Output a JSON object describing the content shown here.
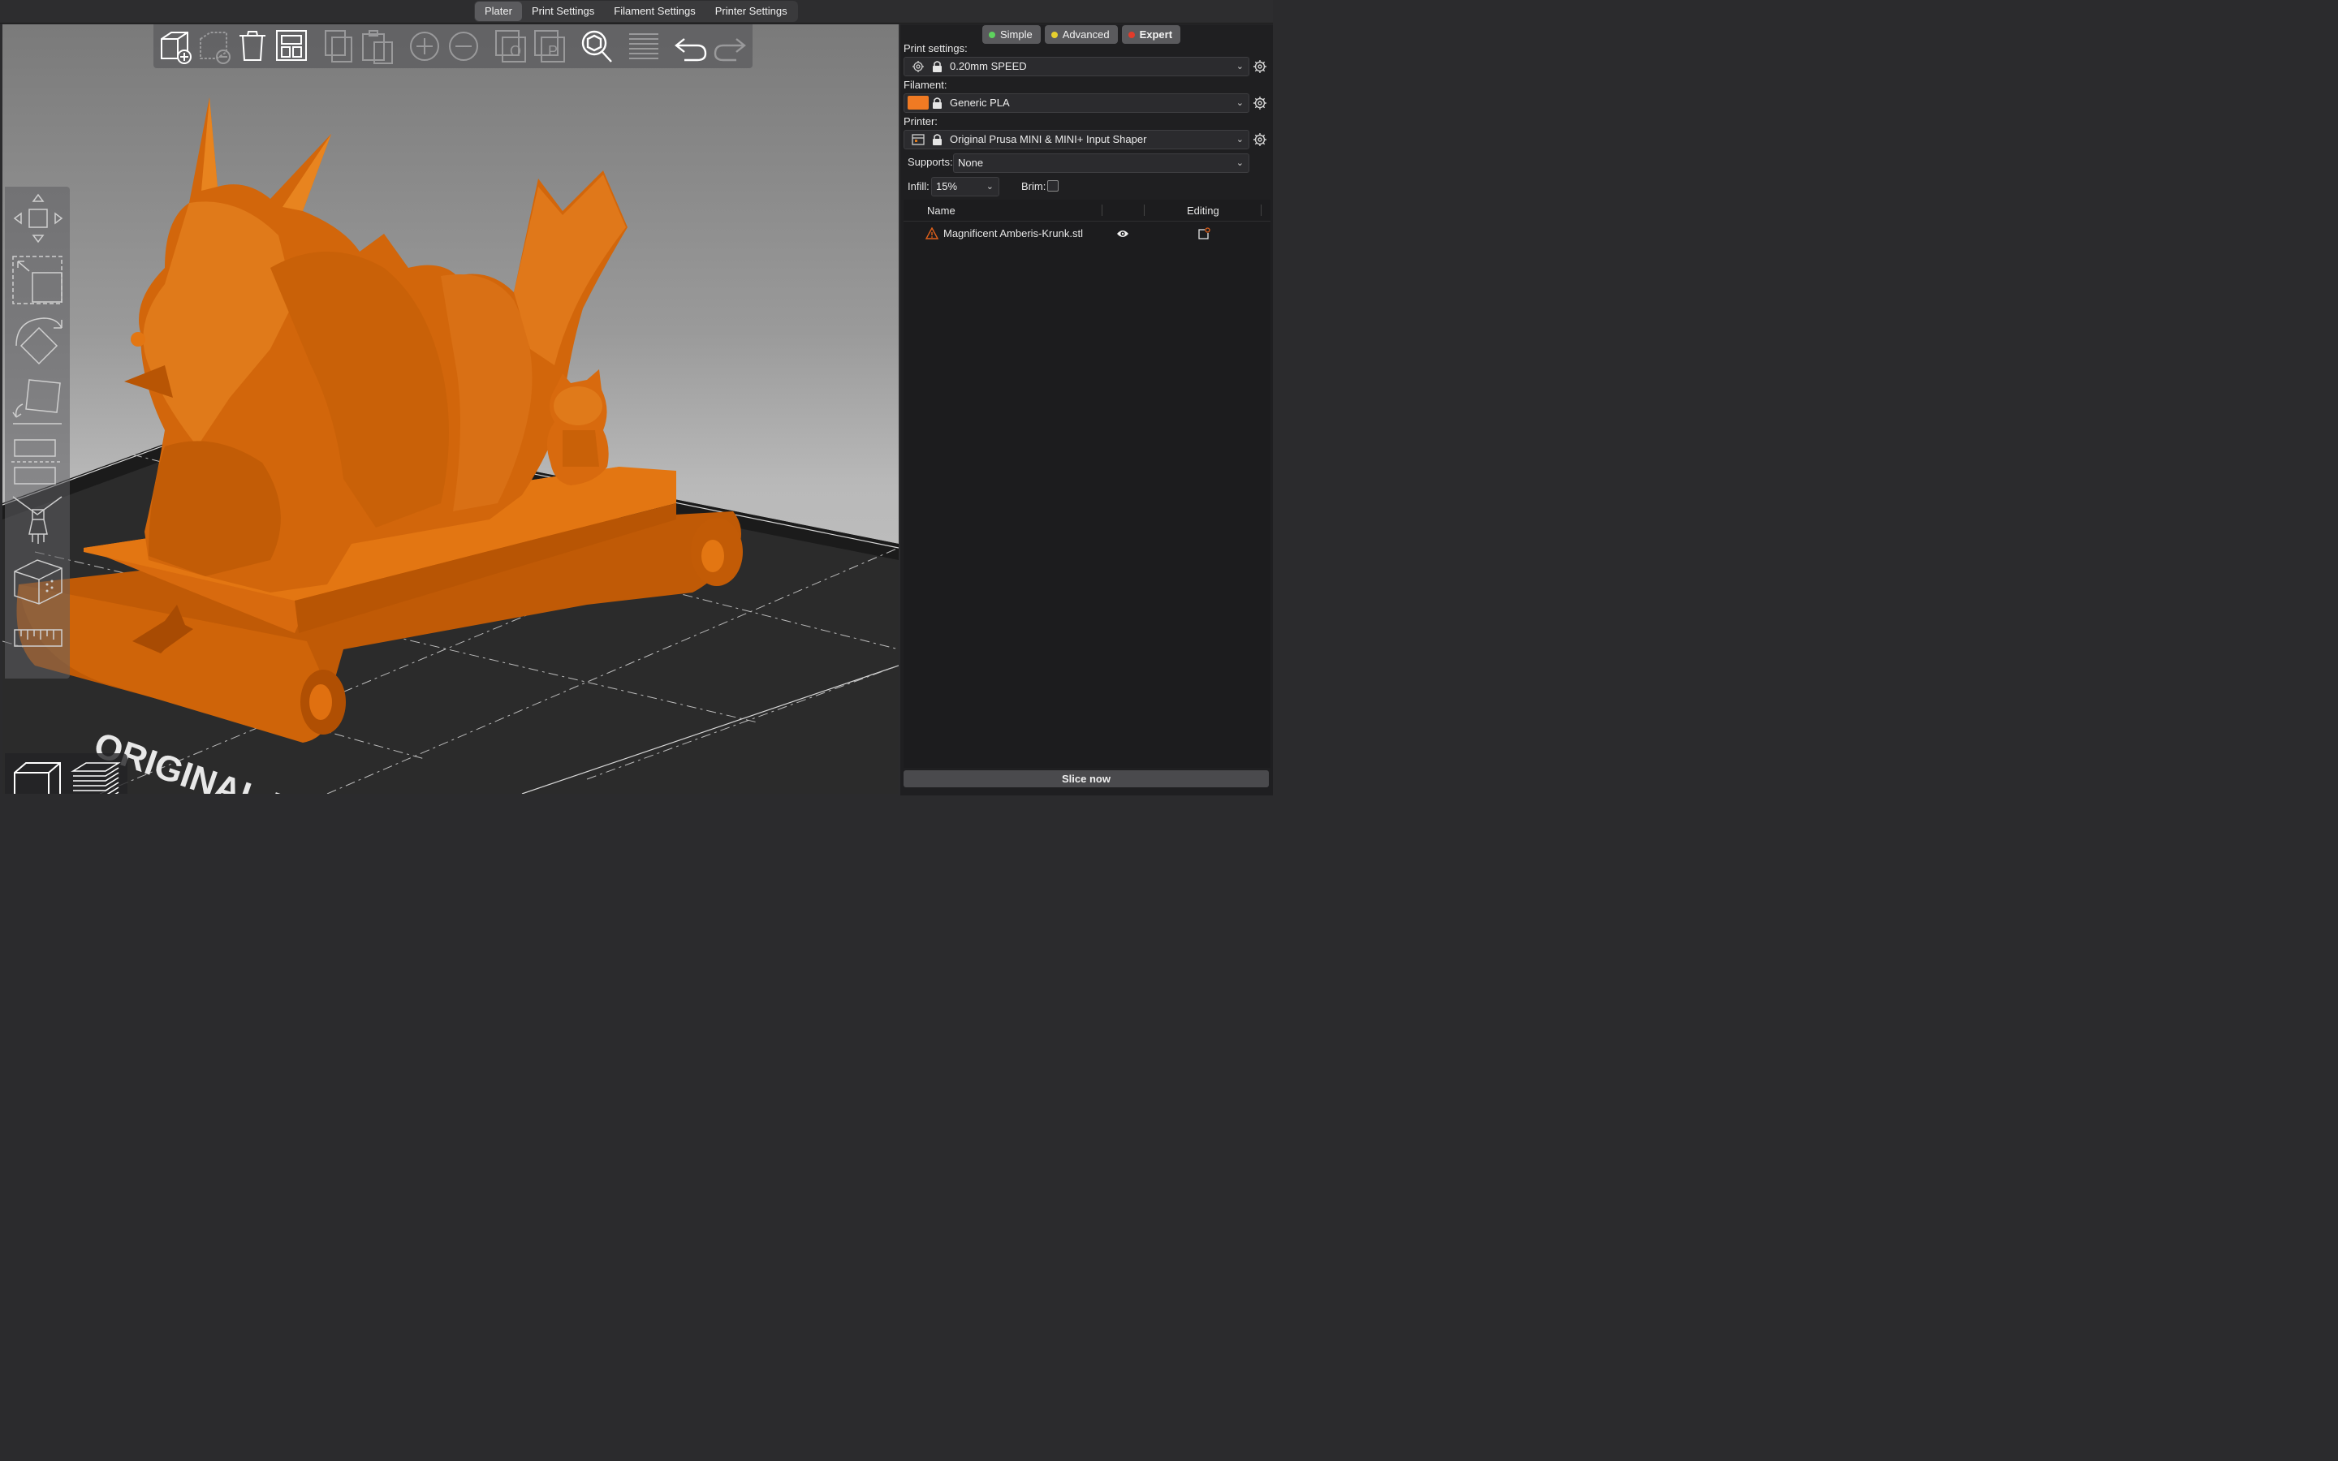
{
  "tabs": [
    "Plater",
    "Print Settings",
    "Filament Settings",
    "Printer Settings"
  ],
  "active_tab": "Plater",
  "modes": {
    "simple": "Simple",
    "advanced": "Advanced",
    "expert": "Expert",
    "colors": {
      "simple": "#5ed35e",
      "advanced": "#e6cf2e",
      "expert": "#e23b2b"
    }
  },
  "print_settings": {
    "label": "Print settings:",
    "value": "0.20mm SPEED"
  },
  "filament": {
    "label": "Filament:",
    "value": "Generic PLA",
    "color": "#f07a23"
  },
  "printer": {
    "label": "Printer:",
    "value": "Original Prusa MINI & MINI+ Input Shaper"
  },
  "supports": {
    "label": "Supports:",
    "value": "None"
  },
  "infill": {
    "label": "Infill:",
    "value": "15%"
  },
  "brim": {
    "label": "Brim:",
    "checked": false
  },
  "object_list": {
    "col_name": "Name",
    "col_editing": "Editing",
    "items": [
      {
        "name": "Magnificent Amberis-Krunk.stl",
        "warning": true,
        "visible": true
      }
    ]
  },
  "slice_button": "Slice now",
  "bed_text": "ORIGINAL PR",
  "toolbar_icons": [
    "add-icon",
    "delete-icon",
    "delete-all-icon",
    "arrange-icon",
    "copy-icon",
    "paste-icon",
    "add-instance-icon",
    "remove-instance-icon",
    "split-objects-icon",
    "split-parts-icon",
    "search-icon",
    "layers-editing-icon",
    "undo-icon",
    "redo-icon"
  ],
  "accent_color": "#d86a0e"
}
